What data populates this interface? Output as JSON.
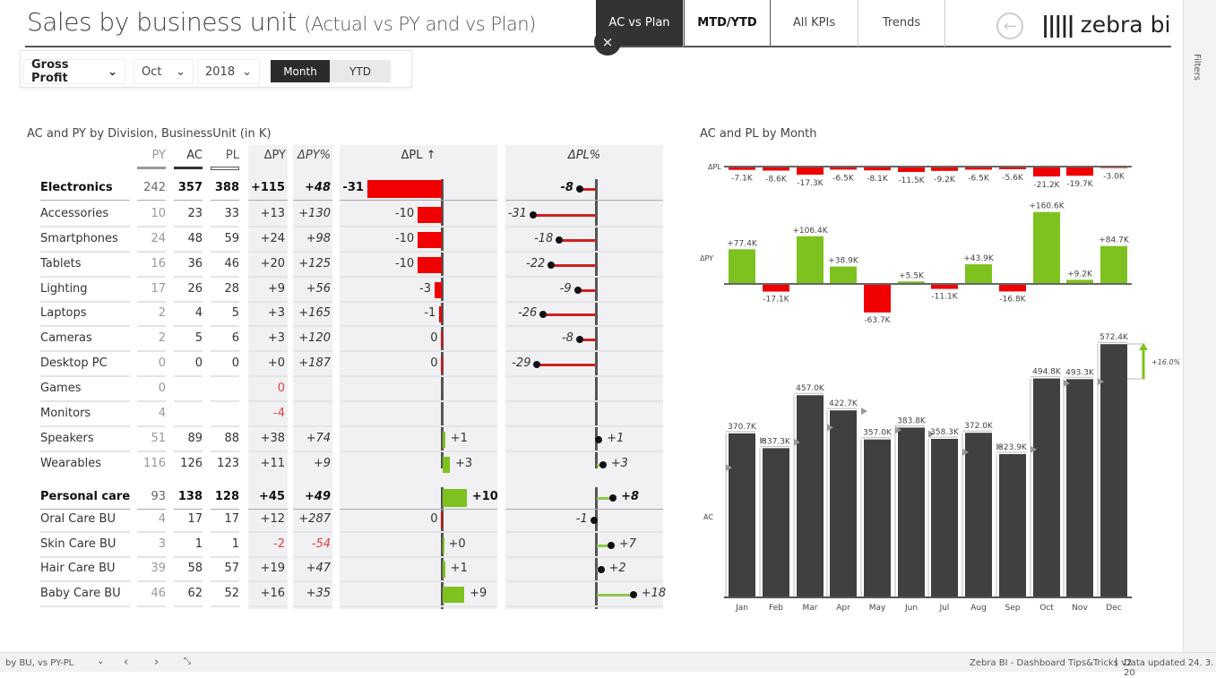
{
  "header": {
    "title": "Sales by business unit",
    "subtitle": "(Actual vs PY and vs Plan)",
    "close": "×",
    "back": "←",
    "logo": "zebra bi"
  },
  "nav": [
    {
      "label": "AC vs Plan",
      "active": true
    },
    {
      "label": "MTD/YTD",
      "hover": true
    },
    {
      "label": "All KPIs"
    },
    {
      "label": "Trends"
    }
  ],
  "filters": {
    "measure": "Gross Profit",
    "month": "Oct",
    "year": "2018",
    "period_options": [
      "Month",
      "YTD"
    ],
    "period_selected": "Month"
  },
  "side": {
    "filters_label": "Filters"
  },
  "table": {
    "title": "AC and PY by Division, BusinessUnit (in K)",
    "columns": [
      "PY",
      "AC",
      "PL",
      "ΔPY",
      "ΔPY%",
      "ΔPL ↑",
      "ΔPL%"
    ],
    "rows": [
      {
        "name": "Electronics",
        "bold": true,
        "py": "242",
        "ac": "357",
        "pl": "388",
        "dpy": "+115",
        "dpyp": "+48",
        "dpl": -31,
        "dpl_l": "-31",
        "dplp": -8,
        "dplp_l": "-8"
      },
      {
        "name": "Accessories",
        "py": "10",
        "ac": "23",
        "pl": "33",
        "dpy": "+13",
        "dpyp": "+130",
        "dpl": -10,
        "dpl_l": "-10",
        "dplp": -31,
        "dplp_l": "-31"
      },
      {
        "name": "Smartphones",
        "py": "24",
        "ac": "48",
        "pl": "59",
        "dpy": "+24",
        "dpyp": "+98",
        "dpl": -10,
        "dpl_l": "-10",
        "dplp": -18,
        "dplp_l": "-18"
      },
      {
        "name": "Tablets",
        "py": "16",
        "ac": "36",
        "pl": "46",
        "dpy": "+20",
        "dpyp": "+125",
        "dpl": -10,
        "dpl_l": "-10",
        "dplp": -22,
        "dplp_l": "-22"
      },
      {
        "name": "Lighting",
        "py": "17",
        "ac": "26",
        "pl": "28",
        "dpy": "+9",
        "dpyp": "+56",
        "dpl": -3,
        "dpl_l": "-3",
        "dplp": -9,
        "dplp_l": "-9"
      },
      {
        "name": "Laptops",
        "py": "2",
        "ac": "4",
        "pl": "5",
        "dpy": "+3",
        "dpyp": "+165",
        "dpl": -1,
        "dpl_l": "-1",
        "dplp": -26,
        "dplp_l": "-26"
      },
      {
        "name": "Cameras",
        "py": "2",
        "ac": "5",
        "pl": "6",
        "dpy": "+3",
        "dpyp": "+120",
        "dpl": -0.2,
        "dpl_l": "0",
        "dplp": -8,
        "dplp_l": "-8"
      },
      {
        "name": "Desktop PC",
        "py": "0",
        "ac": "0",
        "pl": "0",
        "dpy": "+0",
        "dpyp": "+187",
        "dpl": -0.2,
        "dpl_l": "0",
        "dplp": -29,
        "dplp_l": "-29"
      },
      {
        "name": "Games",
        "py": "0",
        "ac": "",
        "pl": "",
        "dpy": "0",
        "dpy_neg": true,
        "dpyp": ""
      },
      {
        "name": "Monitors",
        "py": "4",
        "ac": "",
        "pl": "",
        "dpy": "-4",
        "dpy_neg": true,
        "dpyp": ""
      },
      {
        "name": "Speakers",
        "py": "51",
        "ac": "89",
        "pl": "88",
        "dpy": "+38",
        "dpyp": "+74",
        "dpl": 1,
        "dpl_l": "+1",
        "dplp": 1,
        "dplp_l": "+1"
      },
      {
        "name": "Wearables",
        "py": "116",
        "ac": "126",
        "pl": "123",
        "dpy": "+11",
        "dpyp": "+9",
        "dpl": 3,
        "dpl_l": "+3",
        "dplp": 3,
        "dplp_l": "+3"
      },
      {
        "name": "Personal care",
        "bold": true,
        "py": "93",
        "ac": "138",
        "pl": "128",
        "dpy": "+45",
        "dpyp": "+49",
        "dpl": 10,
        "dpl_l": "+10",
        "dplp": 8,
        "dplp_l": "+8"
      },
      {
        "name": "Oral Care BU",
        "py": "4",
        "ac": "17",
        "pl": "17",
        "dpy": "+12",
        "dpyp": "+287",
        "dpl": -0.2,
        "dpl_l": "0",
        "dplp": -1,
        "dplp_l": "-1"
      },
      {
        "name": "Skin Care BU",
        "py": "3",
        "ac": "1",
        "pl": "1",
        "dpy": "-2",
        "dpy_neg": true,
        "dpyp": "-54",
        "dpyp_neg": true,
        "dpl": 0.2,
        "dpl_l": "+0",
        "dplp": 7,
        "dplp_l": "+7"
      },
      {
        "name": "Hair Care BU",
        "py": "39",
        "ac": "58",
        "pl": "57",
        "dpy": "+19",
        "dpyp": "+47",
        "dpl": 1,
        "dpl_l": "+1",
        "dplp": 2,
        "dplp_l": "+2"
      },
      {
        "name": "Baby Care BU",
        "py": "46",
        "ac": "62",
        "pl": "52",
        "dpy": "+16",
        "dpyp": "+35",
        "dpl": 9,
        "dpl_l": "+9",
        "dplp": 18,
        "dplp_l": "+18"
      }
    ]
  },
  "chart_data": {
    "type": "bar",
    "title": "AC and PL by Month",
    "categories": [
      "Jan",
      "Feb",
      "Mar",
      "Apr",
      "May",
      "Jun",
      "Jul",
      "Aug",
      "Sep",
      "Oct",
      "Nov",
      "Dec"
    ],
    "series": [
      {
        "name": "ΔPL",
        "values": [
          -7.1,
          -8.6,
          -17.3,
          -6.5,
          -8.1,
          -11.5,
          -9.2,
          -6.5,
          -5.6,
          -21.2,
          -19.7,
          -3.0
        ],
        "labels": [
          "-7.1K",
          "-8.6K",
          "-17.3K",
          "-6.5K",
          "-8.1K",
          "-11.5K",
          "-9.2K",
          "-6.5K",
          "-5.6K",
          "-21.2K",
          "-19.7K",
          "-3.0K"
        ]
      },
      {
        "name": "ΔPY",
        "values": [
          77.4,
          -17.1,
          106.4,
          38.9,
          -63.7,
          5.5,
          -11.1,
          43.9,
          -16.8,
          160.6,
          9.2,
          84.7
        ],
        "labels": [
          "+77.4K",
          "-17.1K",
          "+106.4K",
          "+38.9K",
          "-63.7K",
          "+5.5K",
          "-11.1K",
          "+43.9K",
          "-16.8K",
          "+160.6K",
          "+9.2K",
          "+84.7K"
        ]
      },
      {
        "name": "AC",
        "values": [
          370.7,
          337.3,
          457.0,
          422.7,
          357.0,
          383.8,
          358.3,
          372.0,
          323.9,
          494.8,
          493.3,
          572.4
        ],
        "labels": [
          "370.7K",
          "337.3K",
          "457.0K",
          "422.7K",
          "357.0K",
          "383.8K",
          "358.3K",
          "372.0K",
          "323.9K",
          "494.8K",
          "493.3K",
          "572.4K"
        ]
      }
    ],
    "annotation": "+16.0%",
    "colors": {
      "positive": "#7dc21e",
      "negative": "#f00000",
      "ac": "#404040"
    }
  },
  "footer": {
    "page": "by BU, vs PY-PL",
    "status": "Zebra BI - Dashboard Tips&Tricks v2",
    "updated": "Data updated 24. 3. 20"
  }
}
